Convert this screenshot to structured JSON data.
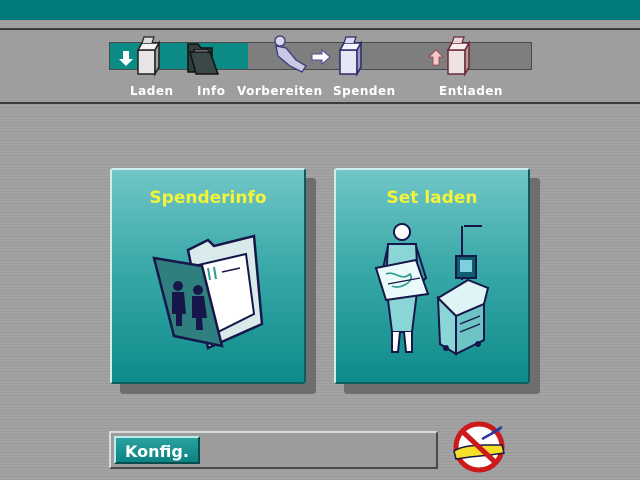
{
  "colors": {
    "accent": "#007a7a",
    "title": "#f4f43a",
    "progress": "#0b8a86"
  },
  "steps": [
    {
      "label": "Laden",
      "icon": "download-machine-icon",
      "state": "done"
    },
    {
      "label": "Info",
      "icon": "folder-icon",
      "state": "active"
    },
    {
      "label": "Vorbereiten",
      "icon": "donor-reclined-icon",
      "state": "pending"
    },
    {
      "label": "Spenden",
      "icon": "donation-machine-icon",
      "state": "pending"
    },
    {
      "label": "Entladen",
      "icon": "unload-machine-icon",
      "state": "pending"
    }
  ],
  "cards": [
    {
      "title": "Spenderinfo",
      "icon": "donor-info-folder-icon"
    },
    {
      "title": "Set laden",
      "icon": "load-set-icon"
    }
  ],
  "footer": {
    "config_label": "Konfig.",
    "status_icon": "no-arm-icon"
  }
}
